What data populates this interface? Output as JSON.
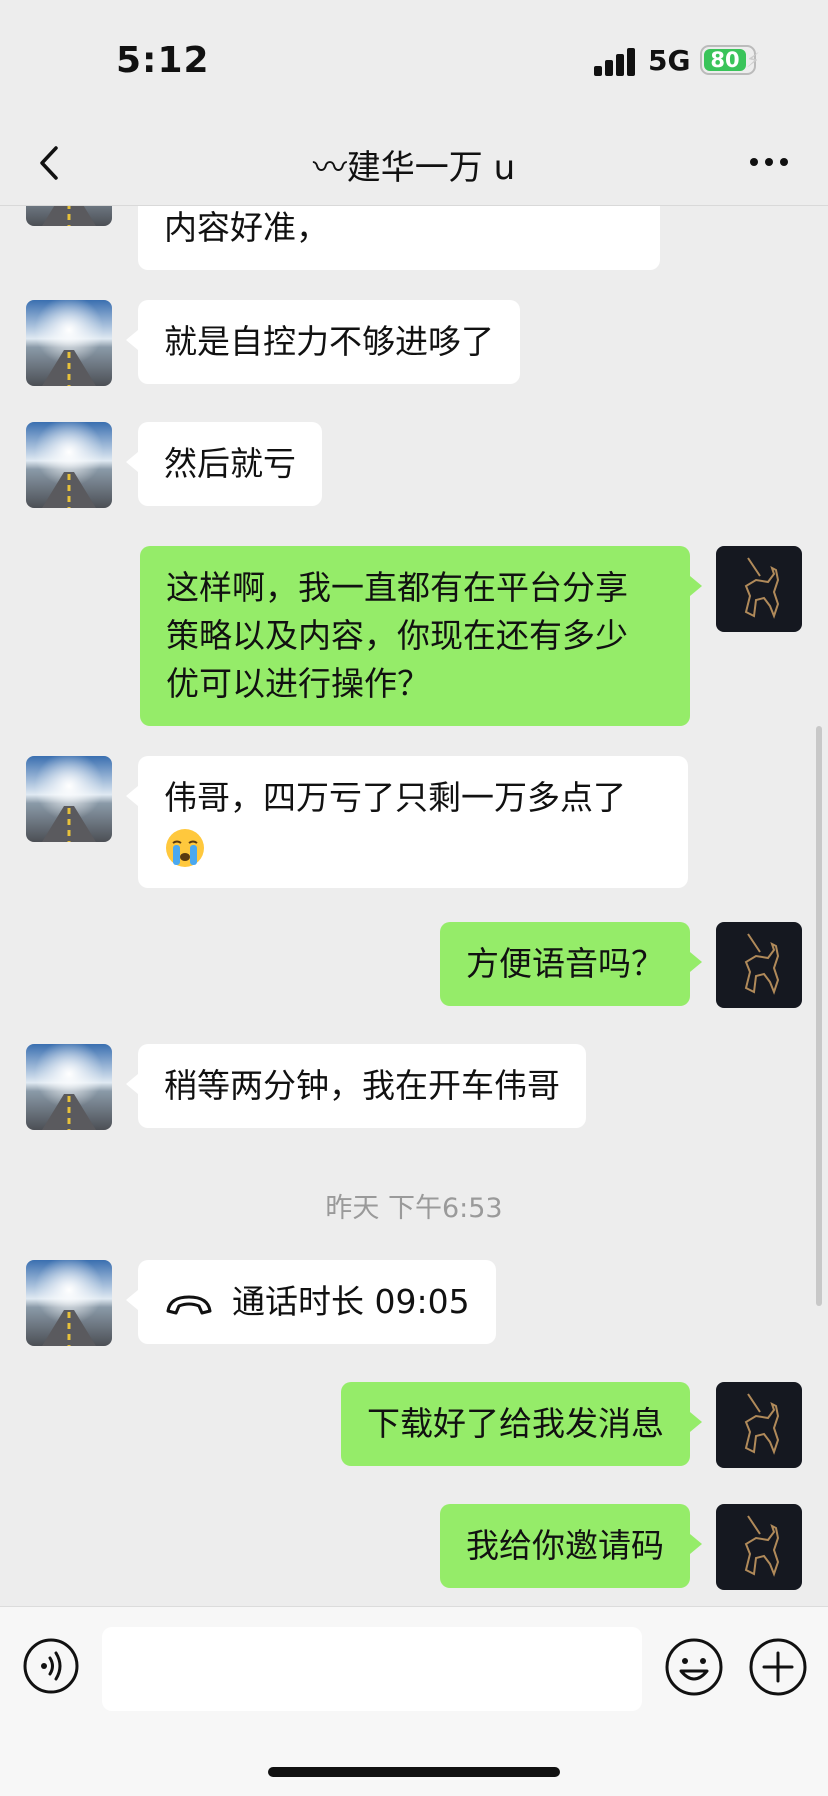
{
  "status_bar": {
    "time": "5:12",
    "network": "5G",
    "battery": "80"
  },
  "nav": {
    "title": "〰建华一万 u"
  },
  "messages": [
    {
      "from": "contact",
      "text": "内容好准，"
    },
    {
      "from": "contact",
      "text": "就是自控力不够进哆了"
    },
    {
      "from": "contact",
      "text": "然后就亏"
    },
    {
      "from": "me",
      "lines": [
        "这样啊，我一直都有在平台分享",
        "策略以及内容，你现在还有多少",
        "优可以进行操作？"
      ]
    },
    {
      "from": "contact",
      "text": "伟哥，四万亏了只剩一万多点了",
      "emoji": "crying-face"
    },
    {
      "from": "me",
      "text": "方便语音吗？"
    },
    {
      "from": "contact",
      "text": "稍等两分钟，我在开车伟哥"
    },
    {
      "type": "timestamp",
      "text": "昨天 下午6:53"
    },
    {
      "from": "contact",
      "type": "call",
      "text": "通话时长 09:05"
    },
    {
      "from": "me",
      "text": "下载好了给我发消息"
    },
    {
      "from": "me",
      "text": "我给你邀请码"
    }
  ],
  "colors": {
    "background": "#ededed",
    "incoming_bubble": "#ffffff",
    "outgoing_bubble": "#95ec69",
    "timestamp": "#9a9a9a"
  },
  "icons": [
    "back-arrow-icon",
    "more-dots-icon",
    "voice-icon",
    "emoji-icon",
    "plus-icon",
    "phone-call-icon"
  ]
}
